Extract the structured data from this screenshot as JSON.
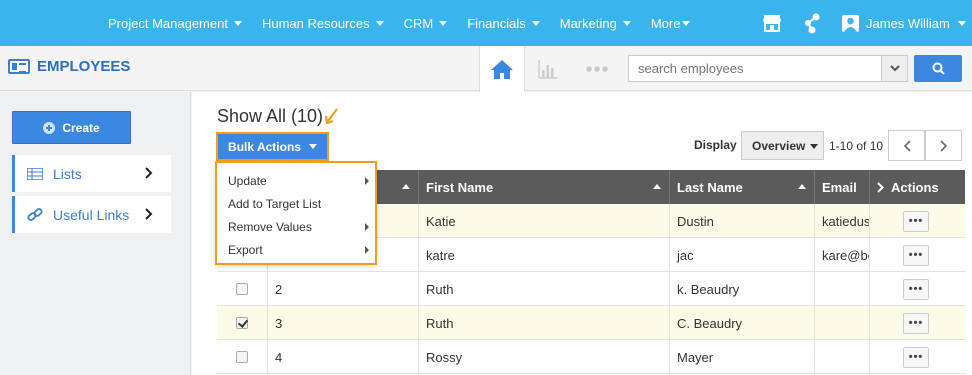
{
  "topnav": {
    "menu": [
      {
        "label": "Project Management"
      },
      {
        "label": "Human Resources"
      },
      {
        "label": "CRM"
      },
      {
        "label": "Financials"
      },
      {
        "label": "Marketing"
      },
      {
        "label": "More"
      }
    ],
    "user_name": "James William",
    "icons": [
      "store-icon",
      "share-icon",
      "user-icon"
    ]
  },
  "module": {
    "title": "EMPLOYEES",
    "search_placeholder": "search employees"
  },
  "sidebar": {
    "create_label": "Create",
    "items": [
      {
        "label": "Lists"
      },
      {
        "label": "Useful Links"
      }
    ]
  },
  "main": {
    "heading": "Show All (10)",
    "bulk_label": "Bulk Actions",
    "display_label": "Display",
    "display_value": "Overview",
    "pager_text": "1-10 of 10"
  },
  "bulk_menu": [
    {
      "label": "Update",
      "has_sub": true
    },
    {
      "label": "Add to Target List",
      "has_sub": false
    },
    {
      "label": "Remove Values",
      "has_sub": true
    },
    {
      "label": "Export",
      "has_sub": true
    }
  ],
  "table": {
    "columns": [
      "",
      "",
      "First Name",
      "Last Name",
      "Email",
      "Actions"
    ],
    "rows": [
      {
        "num": "",
        "first": "Katie",
        "last": "Dustin",
        "email": "katiedust",
        "checked": false,
        "selected": true
      },
      {
        "num": "",
        "first": "katre",
        "last": "jac",
        "email": "kare@be",
        "checked": false,
        "selected": false
      },
      {
        "num": "2",
        "first": "Ruth",
        "last": "k. Beaudry",
        "email": "",
        "checked": false,
        "selected": false
      },
      {
        "num": "3",
        "first": "Ruth",
        "last": "C. Beaudry",
        "email": "",
        "checked": true,
        "selected": true
      },
      {
        "num": "4",
        "first": "Rossy",
        "last": "Mayer",
        "email": "",
        "checked": false,
        "selected": false
      }
    ],
    "action_label": "•••"
  },
  "colors": {
    "topbar": "#3ab4ec",
    "primary": "#3b88e0",
    "highlight": "#f29b1d",
    "header_row": "#5b5b5b",
    "selected_row": "#fbfbe7"
  }
}
